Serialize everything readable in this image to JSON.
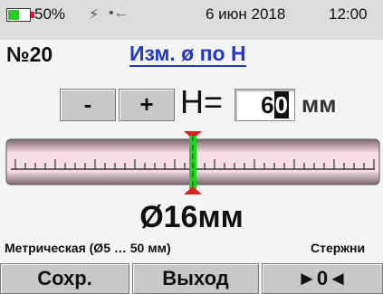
{
  "status_bar": {
    "battery_percent": "50%",
    "battery_level": 0.5,
    "charging_icon": "lightning-icon",
    "usb_icon": "usb-icon",
    "date": "6 июн 2018",
    "time": "12:00"
  },
  "header": {
    "record_number": "№20",
    "mode_title": "Изм. ø по H"
  },
  "controls": {
    "minus_label": "-",
    "plus_label": "+",
    "h_label": "H=",
    "h_digit_first": "6",
    "h_digit_active": "0",
    "h_unit": "мм"
  },
  "indicator": {
    "marker_position": 0.5
  },
  "result": {
    "diameter": "Ø16мм",
    "range_text": "Метрическая (Ø5 … 50 мм)",
    "type_text": "Стержни"
  },
  "softkeys": {
    "save": "Сохр.",
    "exit": "Выход",
    "zero": "►0◄"
  },
  "colors": {
    "accent_blue": "#2438c8",
    "battery_green": "#2ec82e",
    "marker_red": "#e02020",
    "marker_green": "#22d022",
    "bar_pink": "#f6dde6"
  }
}
